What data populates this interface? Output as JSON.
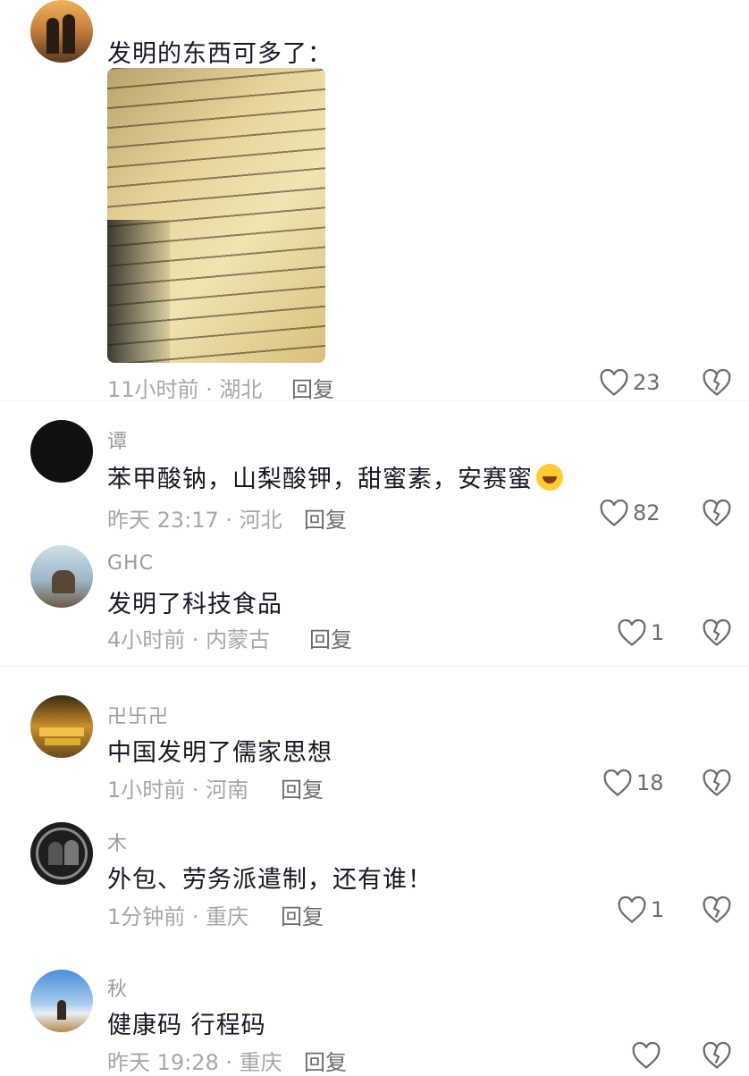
{
  "comments": [
    {
      "username": "",
      "text": "发明的东西可多了：",
      "time": "11小时前 · 湖北",
      "reply_label": "回复",
      "likes": "23",
      "has_image": true,
      "avatar_colors": [
        "#c9823e",
        "#5a3a22"
      ]
    },
    {
      "username": "谭",
      "text": "苯甲酸钠，山梨酸钾，甜蜜素，安赛蜜",
      "emoji": "rolling-on-floor-laughing",
      "time": "昨天 23:17 · 河北",
      "reply_label": "回复",
      "likes": "82",
      "avatar_colors": [
        "#111111",
        "#2a2a2a"
      ]
    },
    {
      "username": "GHC",
      "text": "发明了科技食品",
      "time": "4小时前 · 内蒙古",
      "reply_label": "回复",
      "likes": "1",
      "avatar_colors": [
        "#9fb7c9",
        "#6e5b44"
      ]
    },
    {
      "username": "卍卐卍",
      "text": "中国发明了儒家思想",
      "time": "1小时前 · 河南",
      "reply_label": "回复",
      "likes": "18",
      "avatar_colors": [
        "#c98f2b",
        "#6b4b1e"
      ]
    },
    {
      "username": "木",
      "text": "外包、劳务派遣制，还有谁！",
      "time": "1分钟前 · 重庆",
      "reply_label": "回复",
      "likes": "1",
      "avatar_colors": [
        "#1e1e1e",
        "#8a8a8a"
      ]
    },
    {
      "username": "秋",
      "text": "健康码 行程码",
      "time": "昨天 19:28 · 重庆",
      "reply_label": "回复",
      "likes": "",
      "avatar_colors": [
        "#4a8fd6",
        "#e9eef5"
      ]
    }
  ],
  "icons": {
    "like": "heart-outline-icon",
    "dislike": "broken-heart-icon"
  },
  "colors": {
    "text": "#161823",
    "meta": "#a7a7ab",
    "icon": "#6b6b70"
  }
}
